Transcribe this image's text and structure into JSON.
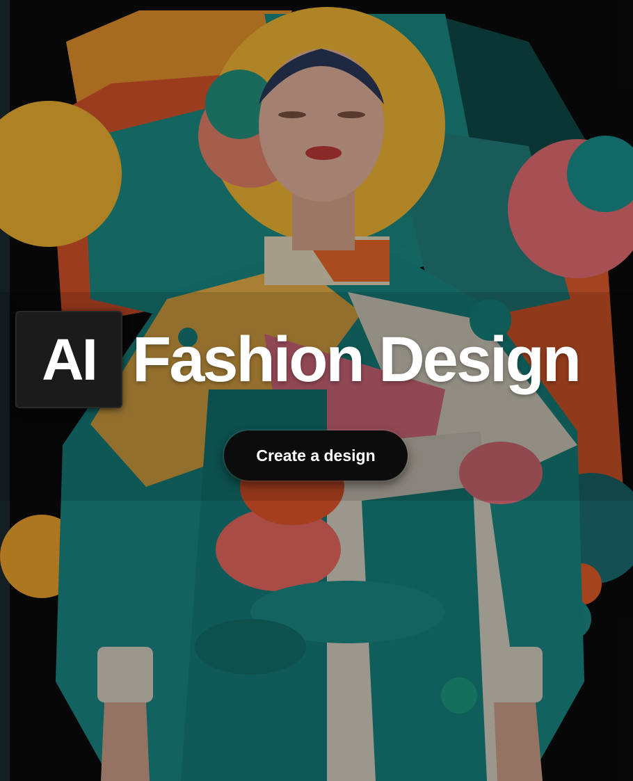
{
  "hero": {
    "title_badge": "AI",
    "title_rest": "Fashion Design",
    "cta_label": "Create a design"
  },
  "colors": {
    "background": "#0a0a0a",
    "teal": "#1f8a84",
    "orange": "#e8622e",
    "yellow": "#f0b43a",
    "pink": "#e4748a",
    "cream": "#e8e0cf",
    "button": "#0c0c0c"
  }
}
